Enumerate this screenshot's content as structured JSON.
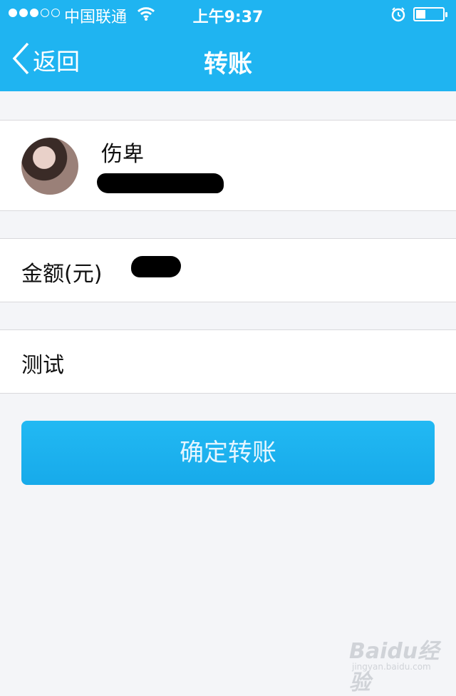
{
  "status_bar": {
    "signal_dots_filled": 3,
    "signal_dots_total": 5,
    "carrier": "中国联通",
    "time": "上午9:37",
    "battery_level": 0.35
  },
  "nav": {
    "back_label": "返回",
    "title": "转账"
  },
  "recipient": {
    "name": "伤卑"
  },
  "amount": {
    "label": "金额(元)"
  },
  "memo": {
    "text": "测试"
  },
  "confirm_button": {
    "label": "确定转账"
  },
  "watermark": {
    "text": "Baidu经验",
    "url": "jingyan.baidu.com"
  },
  "colors": {
    "brand_blue": "#1fb4f1",
    "button_blue": "#1cb2ee",
    "background": "#f4f5f8"
  },
  "icons": [
    "wifi-icon",
    "alarm-icon",
    "battery-icon",
    "chevron-left-icon"
  ]
}
